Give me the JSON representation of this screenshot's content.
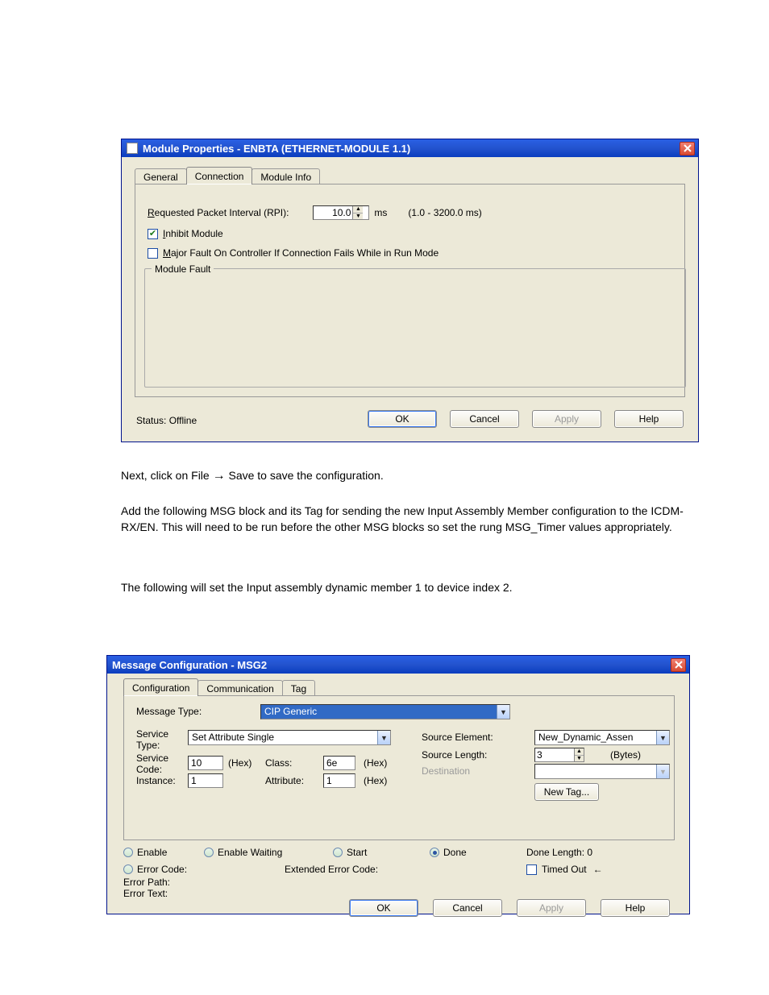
{
  "window1": {
    "title": "Module Properties  - ENBTA (ETHERNET-MODULE 1.1)",
    "tabs": [
      "General",
      "Connection",
      "Module Info"
    ],
    "active_tab": 1,
    "rpi_label_pre": "R",
    "rpi_label": "equested Packet Interval (RPI):",
    "rpi_value": "10.0",
    "rpi_unit": "ms",
    "rpi_range": "(1.0 - 3200.0 ms)",
    "inhibit_label_pre": "I",
    "inhibit_label": "nhibit Module",
    "inhibit_checked": true,
    "major_label_pre": "M",
    "major_label": "ajor Fault On Controller If Connection Fails While in Run Mode",
    "major_checked": false,
    "group_label": "Module Fault",
    "status_label": "Status:  Offline",
    "buttons": {
      "ok": "OK",
      "cancel": "Cancel",
      "apply": "Apply",
      "help": "Help"
    }
  },
  "mid_text": {
    "line1a": "Next, click on File ",
    "line1b": " Save to save the configuration.",
    "p2": "Add the following MSG block and its Tag for sending the new Input Assembly Member configuration to the ICDM-RX/EN. This will need to be run before the other MSG blocks so set the rung MSG_Timer values appropriately.",
    "p3": "The following will set the Input assembly dynamic member 1 to device index 2."
  },
  "window2": {
    "title": "Message Configuration - MSG2",
    "tabs": [
      "Configuration",
      "Communication",
      "Tag"
    ],
    "active_tab": 0,
    "msgtype_label": "Message Type:",
    "msgtype_value": "CIP Generic",
    "svc_type_label": "Service\nType:",
    "svc_type_value": "Set Attribute Single",
    "svc_code_label": "Service\nCode:",
    "svc_code_value": "10",
    "hex": "(Hex)",
    "class_label": "Class:",
    "class_value": "6e",
    "instance_label": "Instance:",
    "instance_value": "1",
    "attribute_label": "Attribute:",
    "attribute_value": "1",
    "src_elem_label": "Source Element:",
    "src_elem_value": "New_Dynamic_Assen",
    "src_len_label": "Source Length:",
    "src_len_value": "3",
    "src_len_unit": "(Bytes)",
    "dest_label": "Destination",
    "newtag_label": "New Tag...",
    "status": {
      "enable": "Enable",
      "enable_waiting": "Enable Waiting",
      "start": "Start",
      "done": "Done",
      "done_len": "Done Length:  0",
      "error_code": "Error Code:",
      "ext_error": "Extended Error Code:",
      "timed_out": "Timed Out",
      "error_path": "Error Path:",
      "error_text": "Error Text:"
    },
    "buttons": {
      "ok": "OK",
      "cancel": "Cancel",
      "apply": "Apply",
      "help": "Help"
    }
  }
}
